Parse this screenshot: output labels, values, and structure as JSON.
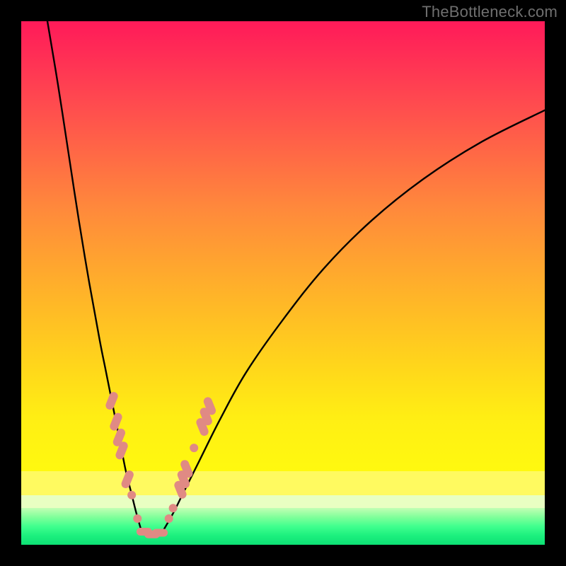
{
  "watermark": "TheBottleneck.com",
  "colors": {
    "curve": "#000000",
    "marker_fill": "#e08a84",
    "marker_stroke": "#cf7a73"
  },
  "chart_data": {
    "type": "line",
    "title": "",
    "xlabel": "",
    "ylabel": "",
    "xlim": [
      0,
      100
    ],
    "ylim": [
      0,
      100
    ],
    "grid": false,
    "series": [
      {
        "name": "left-curve",
        "x": [
          5,
          7,
          9,
          11,
          13,
          15,
          16,
          17,
          18,
          19,
          20,
          21,
          22,
          23
        ],
        "y": [
          100,
          88,
          75,
          62,
          50,
          39,
          34,
          29,
          24,
          19,
          14,
          10,
          6,
          2.5
        ]
      },
      {
        "name": "right-curve",
        "x": [
          27,
          29,
          31,
          34,
          38,
          43,
          50,
          58,
          67,
          77,
          88,
          100
        ],
        "y": [
          2.5,
          6,
          10,
          16,
          24,
          33,
          43,
          53,
          62,
          70,
          77,
          83
        ]
      }
    ],
    "markers": [
      {
        "x": 17.3,
        "y": 27.5,
        "kind": "lozenge"
      },
      {
        "x": 18.1,
        "y": 23.5,
        "kind": "lozenge"
      },
      {
        "x": 18.7,
        "y": 20.5,
        "kind": "lozenge"
      },
      {
        "x": 19.2,
        "y": 18.0,
        "kind": "lozenge"
      },
      {
        "x": 20.3,
        "y": 12.5,
        "kind": "lozenge"
      },
      {
        "x": 21.1,
        "y": 9.5,
        "kind": "dot"
      },
      {
        "x": 22.2,
        "y": 5.0,
        "kind": "dot"
      },
      {
        "x": 23.5,
        "y": 2.5,
        "kind": "lozenge-h"
      },
      {
        "x": 25.0,
        "y": 2.0,
        "kind": "lozenge-h"
      },
      {
        "x": 26.5,
        "y": 2.3,
        "kind": "lozenge-h"
      },
      {
        "x": 28.2,
        "y": 5.0,
        "kind": "dot"
      },
      {
        "x": 29.0,
        "y": 7.0,
        "kind": "dot"
      },
      {
        "x": 30.4,
        "y": 10.5,
        "kind": "lozenge"
      },
      {
        "x": 31.0,
        "y": 12.5,
        "kind": "lozenge"
      },
      {
        "x": 31.6,
        "y": 14.5,
        "kind": "lozenge"
      },
      {
        "x": 33.0,
        "y": 18.5,
        "kind": "dot"
      },
      {
        "x": 34.6,
        "y": 22.5,
        "kind": "lozenge"
      },
      {
        "x": 35.3,
        "y": 24.5,
        "kind": "lozenge"
      },
      {
        "x": 36.0,
        "y": 26.5,
        "kind": "lozenge"
      }
    ]
  }
}
